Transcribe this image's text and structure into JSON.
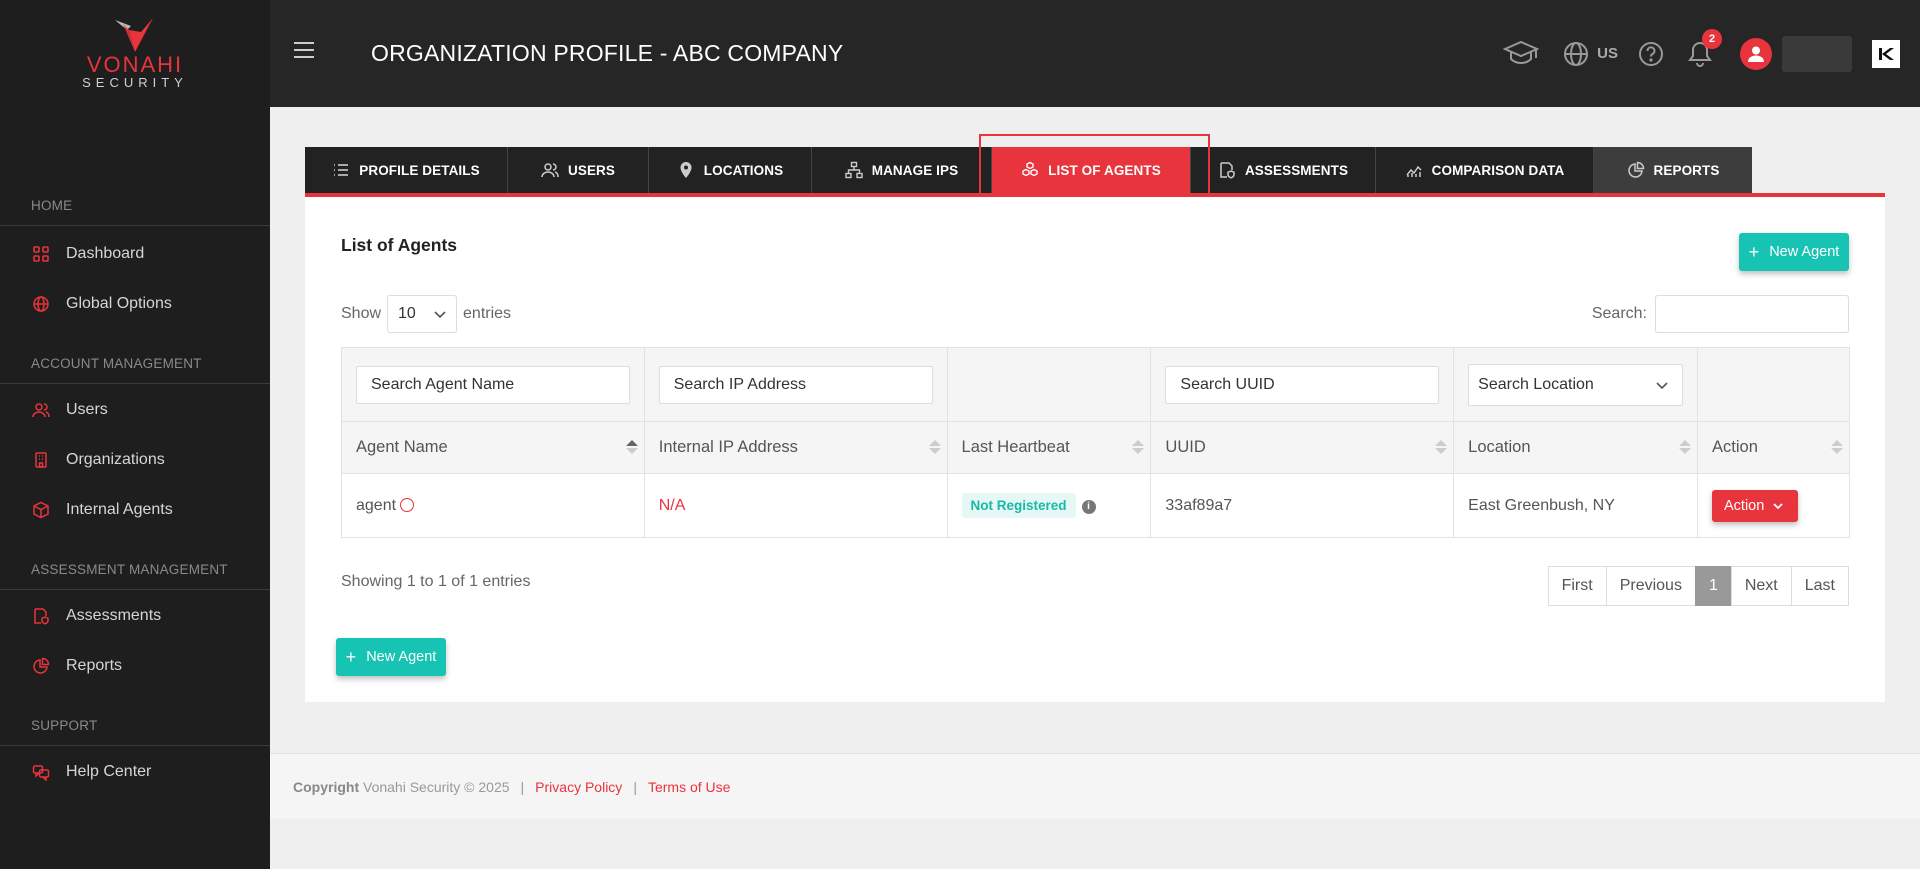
{
  "brand": {
    "name": "VONAHI",
    "sub": "SECURITY"
  },
  "sidebar": {
    "sections": [
      {
        "title": "HOME",
        "items": [
          {
            "label": "Dashboard"
          },
          {
            "label": "Global Options"
          }
        ]
      },
      {
        "title": "ACCOUNT MANAGEMENT",
        "items": [
          {
            "label": "Users"
          },
          {
            "label": "Organizations"
          },
          {
            "label": "Internal Agents"
          }
        ]
      },
      {
        "title": "ASSESSMENT MANAGEMENT",
        "items": [
          {
            "label": "Assessments"
          },
          {
            "label": "Reports"
          }
        ]
      },
      {
        "title": "SUPPORT",
        "items": [
          {
            "label": "Help Center"
          }
        ]
      }
    ]
  },
  "header": {
    "title": "ORGANIZATION PROFILE - ABC COMPANY",
    "locale": "US",
    "notification_count": "2"
  },
  "tabs": [
    {
      "label": "PROFILE DETAILS",
      "icon": "list-icon"
    },
    {
      "label": "USERS",
      "icon": "users-icon"
    },
    {
      "label": "LOCATIONS",
      "icon": "pin-icon"
    },
    {
      "label": "MANAGE IPS",
      "icon": "network-icon"
    },
    {
      "label": "LIST OF AGENTS",
      "icon": "agents-icon",
      "active": true
    },
    {
      "label": "ASSESSMENTS",
      "icon": "assessment-icon"
    },
    {
      "label": "COMPARISON DATA",
      "icon": "chart-icon"
    },
    {
      "label": "REPORTS",
      "icon": "pie-icon"
    }
  ],
  "panel": {
    "title": "List of Agents",
    "new_agent_label": "New Agent",
    "show_label": "Show",
    "entries_value": "10",
    "entries_label": "entries",
    "search_label": "Search:"
  },
  "table": {
    "filters": {
      "agent_name": "Search Agent Name",
      "ip": "Search IP Address",
      "uuid": "Search UUID",
      "location": "Search Location"
    },
    "columns": [
      "Agent Name",
      "Internal IP Address",
      "Last Heartbeat",
      "UUID",
      "Location",
      "Action"
    ],
    "rows": [
      {
        "agent_name": "agent",
        "ip": "N/A",
        "heartbeat": "Not Registered",
        "uuid": "33af89a7",
        "location": "East Greenbush, NY",
        "action": "Action"
      }
    ]
  },
  "footer_info": {
    "showing": "Showing 1 to 1 of 1 entries",
    "pager": [
      "First",
      "Previous",
      "1",
      "Next",
      "Last"
    ]
  },
  "footer": {
    "copyright_label": "Copyright",
    "copyright_text": "Vonahi Security © 2025",
    "privacy": "Privacy Policy",
    "terms": "Terms of Use"
  },
  "colors": {
    "accent": "#e8343c",
    "teal": "#17c3b2",
    "sidebar": "#1e1e1e",
    "header": "#262626"
  }
}
